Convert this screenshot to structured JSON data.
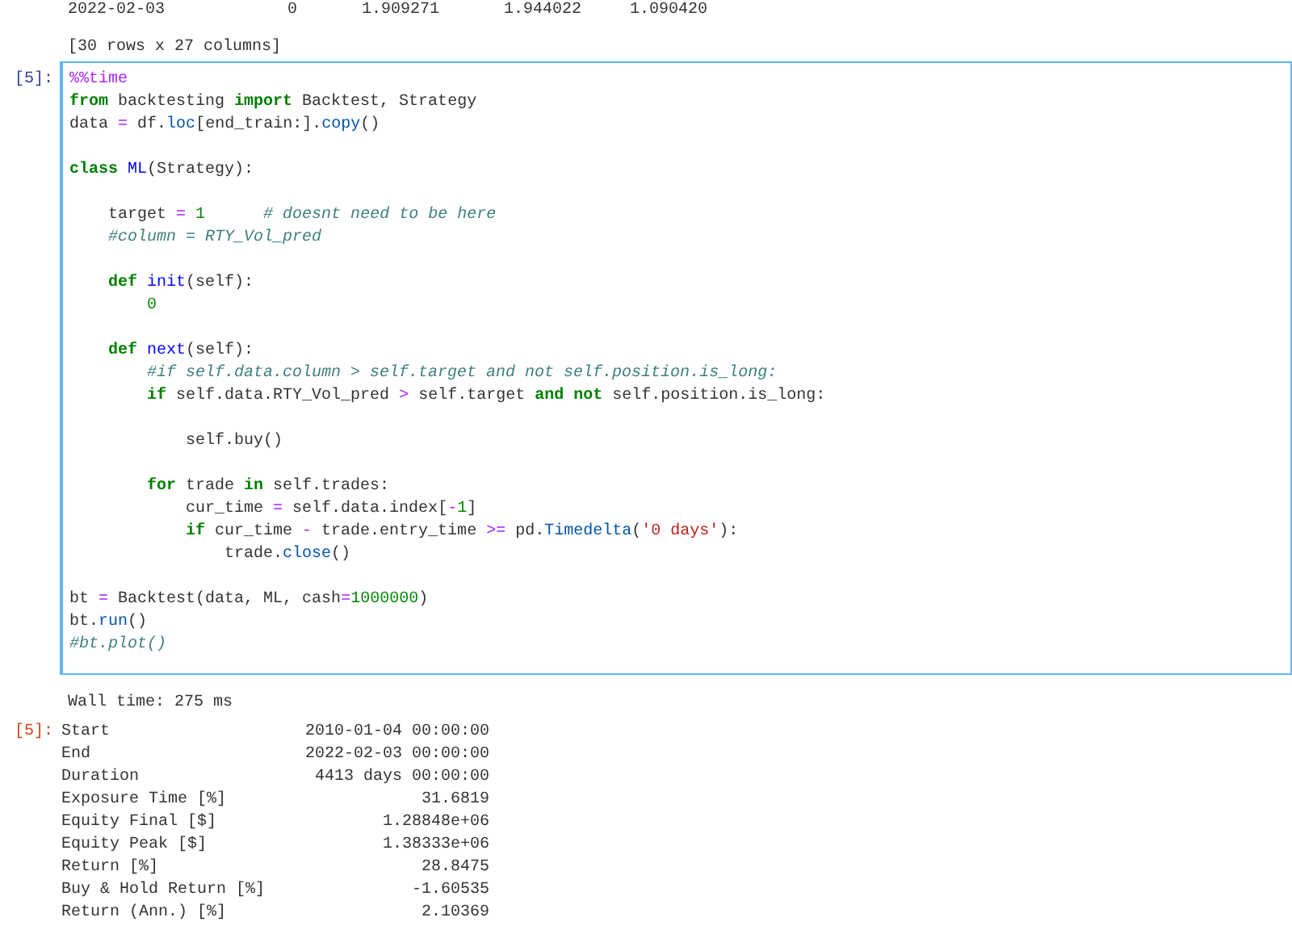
{
  "previous_output": {
    "table_row": [
      "2022-02-03",
      "0",
      "1.909271",
      "1.944022",
      "1.090420"
    ],
    "shape_note": "[30 rows x 27 columns]"
  },
  "cell": {
    "prompt": "[5]:",
    "selected": true,
    "lines": [
      {
        "kind": "code",
        "tokens": [
          {
            "kind": "magic",
            "text": "%%time"
          }
        ]
      },
      {
        "kind": "code",
        "tokens": [
          {
            "kind": "kw",
            "text": "from"
          },
          {
            "kind": "p",
            "text": " backtesting "
          },
          {
            "kind": "kw",
            "text": "import"
          },
          {
            "kind": "p",
            "text": " Backtest, Strategy"
          }
        ]
      },
      {
        "kind": "code",
        "tokens": [
          {
            "kind": "p",
            "text": "data "
          },
          {
            "kind": "op",
            "text": "="
          },
          {
            "kind": "p",
            "text": " df."
          },
          {
            "kind": "attr",
            "text": "loc"
          },
          {
            "kind": "p",
            "text": "[end_train:]."
          },
          {
            "kind": "attr",
            "text": "copy"
          },
          {
            "kind": "p",
            "text": "()"
          }
        ]
      },
      {
        "kind": "blank"
      },
      {
        "kind": "code",
        "tokens": [
          {
            "kind": "kw",
            "text": "class"
          },
          {
            "kind": "cls",
            "text": " ML"
          },
          {
            "kind": "p",
            "text": "(Strategy):"
          }
        ]
      },
      {
        "kind": "blank"
      },
      {
        "kind": "code",
        "tokens": [
          {
            "kind": "p",
            "text": "    target "
          },
          {
            "kind": "op",
            "text": "="
          },
          {
            "kind": "num",
            "text": " 1"
          },
          {
            "kind": "com",
            "text": "      # doesnt need to be here"
          }
        ]
      },
      {
        "kind": "code",
        "tokens": [
          {
            "kind": "com",
            "text": "    #column = RTY_Vol_pred"
          }
        ]
      },
      {
        "kind": "blank"
      },
      {
        "kind": "code",
        "tokens": [
          {
            "kind": "kw",
            "text": "    def"
          },
          {
            "kind": "fn",
            "text": " init"
          },
          {
            "kind": "p",
            "text": "(self):"
          }
        ]
      },
      {
        "kind": "code",
        "tokens": [
          {
            "kind": "num",
            "text": "        0"
          }
        ]
      },
      {
        "kind": "blank"
      },
      {
        "kind": "code",
        "tokens": [
          {
            "kind": "kw",
            "text": "    def"
          },
          {
            "kind": "fn",
            "text": " next"
          },
          {
            "kind": "p",
            "text": "(self):"
          }
        ]
      },
      {
        "kind": "code",
        "tokens": [
          {
            "kind": "com",
            "text": "        #if self.data.column > self.target and not self.position.is_long:"
          }
        ]
      },
      {
        "kind": "code",
        "tokens": [
          {
            "kind": "kw",
            "text": "        if"
          },
          {
            "kind": "p",
            "text": " self.data.RTY_Vol_pred "
          },
          {
            "kind": "op",
            "text": ">"
          },
          {
            "kind": "p",
            "text": " self.target "
          },
          {
            "kind": "kw",
            "text": "and not"
          },
          {
            "kind": "p",
            "text": " self.position.is_long:"
          }
        ]
      },
      {
        "kind": "blank"
      },
      {
        "kind": "code",
        "tokens": [
          {
            "kind": "p",
            "text": "            self.buy()"
          }
        ]
      },
      {
        "kind": "blank"
      },
      {
        "kind": "code",
        "tokens": [
          {
            "kind": "kw",
            "text": "        for"
          },
          {
            "kind": "p",
            "text": " trade "
          },
          {
            "kind": "kw",
            "text": "in"
          },
          {
            "kind": "p",
            "text": " self.trades:"
          }
        ]
      },
      {
        "kind": "code",
        "tokens": [
          {
            "kind": "p",
            "text": "            cur_time "
          },
          {
            "kind": "op",
            "text": "="
          },
          {
            "kind": "p",
            "text": " self.data.index["
          },
          {
            "kind": "op",
            "text": "-"
          },
          {
            "kind": "num",
            "text": "1"
          },
          {
            "kind": "p",
            "text": "]"
          }
        ]
      },
      {
        "kind": "code",
        "tokens": [
          {
            "kind": "kw",
            "text": "            if"
          },
          {
            "kind": "p",
            "text": " cur_time "
          },
          {
            "kind": "op",
            "text": "-"
          },
          {
            "kind": "p",
            "text": " trade.entry_time "
          },
          {
            "kind": "op",
            "text": ">="
          },
          {
            "kind": "p",
            "text": " pd."
          },
          {
            "kind": "attr",
            "text": "Timedelta"
          },
          {
            "kind": "p",
            "text": "("
          },
          {
            "kind": "str",
            "text": "'0 days'"
          },
          {
            "kind": "p",
            "text": "):"
          }
        ]
      },
      {
        "kind": "code",
        "tokens": [
          {
            "kind": "p",
            "text": "                trade."
          },
          {
            "kind": "attr",
            "text": "close"
          },
          {
            "kind": "p",
            "text": "()"
          }
        ]
      },
      {
        "kind": "blank"
      },
      {
        "kind": "code",
        "tokens": [
          {
            "kind": "p",
            "text": "bt "
          },
          {
            "kind": "op",
            "text": "="
          },
          {
            "kind": "p",
            "text": " Backtest(data, ML, cash"
          },
          {
            "kind": "op",
            "text": "="
          },
          {
            "kind": "num",
            "text": "1000000"
          },
          {
            "kind": "p",
            "text": ")"
          }
        ]
      },
      {
        "kind": "code",
        "tokens": [
          {
            "kind": "p",
            "text": "bt."
          },
          {
            "kind": "attr",
            "text": "run"
          },
          {
            "kind": "p",
            "text": "()"
          }
        ]
      },
      {
        "kind": "code",
        "tokens": [
          {
            "kind": "com",
            "text": "#bt.plot()"
          }
        ]
      }
    ]
  },
  "stream_output": "Wall time: 275 ms",
  "result": {
    "prompt": "[5]:",
    "rows": [
      {
        "label": "Start",
        "value": "2010-01-04 00:00:00"
      },
      {
        "label": "End",
        "value": "2022-02-03 00:00:00"
      },
      {
        "label": "Duration",
        "value": "4413 days 00:00:00"
      },
      {
        "label": "Exposure Time [%]",
        "value": "31.6819"
      },
      {
        "label": "Equity Final [$]",
        "value": "1.28848e+06"
      },
      {
        "label": "Equity Peak [$]",
        "value": "1.38333e+06"
      },
      {
        "label": "Return [%]",
        "value": "28.8475"
      },
      {
        "label": "Buy & Hold Return [%]",
        "value": "-1.60535"
      },
      {
        "label": "Return (Ann.) [%]",
        "value": "2.10369"
      }
    ]
  }
}
